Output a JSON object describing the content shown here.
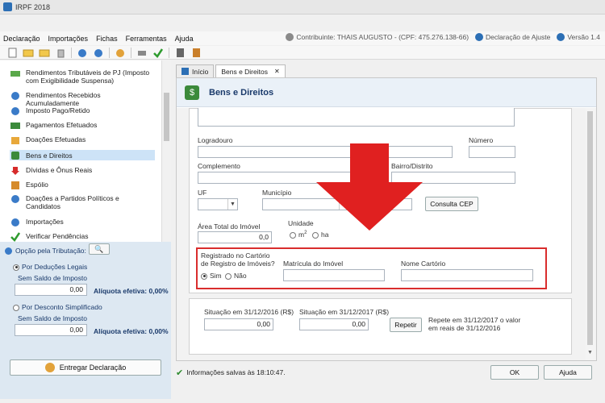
{
  "window": {
    "title": "IRPF 2018"
  },
  "menu": {
    "items": [
      "Declaração",
      "Importações",
      "Fichas",
      "Ferramentas",
      "Ajuda"
    ],
    "contribuinte": "Contribuinte: THAIS AUGUSTO - (CPF: 475.276.138-66)",
    "tipo": "Declaração de Ajuste",
    "versao": "Versão 1.4"
  },
  "sidebar": {
    "items": [
      {
        "label": "Rendimentos Tributáveis de PJ (Imposto com Exigibilidade Suspensa)",
        "icon": "money-icon"
      },
      {
        "label": "Rendimentos Recebidos Acumuladamente",
        "icon": "doc-icon"
      },
      {
        "label": "Imposto Pago/Retido",
        "icon": "tax-icon"
      },
      {
        "label": "Pagamentos Efetuados",
        "icon": "card-icon"
      },
      {
        "label": "Doações Efetuadas",
        "icon": "gift-icon"
      },
      {
        "label": "Bens e Direitos",
        "icon": "assets-icon"
      },
      {
        "label": "Dívidas e Ônus Reais",
        "icon": "down-arrow-icon"
      },
      {
        "label": "Espólio",
        "icon": "grid-icon"
      },
      {
        "label": "Doações a Partidos Políticos e Candidatos",
        "icon": "party-icon"
      },
      {
        "label": "Importações",
        "icon": "import-icon"
      },
      {
        "label": "Verificar Pendências",
        "icon": "check-icon"
      }
    ],
    "opcao_label": "Opção pela Tributação:",
    "deducoes_legais": "Por Deduções Legais",
    "saldo_label_1": "Sem Saldo de Imposto",
    "saldo_value_1": "0,00",
    "aliquota_1": "Alíquota efetiva: 0,00%",
    "desconto_simplificado": "Por Desconto Simplificado",
    "saldo_label_2": "Sem Saldo de Imposto",
    "saldo_value_2": "0,00",
    "aliquota_2": "Alíquota efetiva: 0,00%",
    "entregar": "Entregar Declaração"
  },
  "tabs": [
    {
      "label": "Início"
    },
    {
      "label": "Bens e Direitos"
    }
  ],
  "section": {
    "title": "Bens e Direitos"
  },
  "form": {
    "logradouro": "Logradouro",
    "numero": "Número",
    "complemento": "Complemento",
    "bairro": "Bairro/Distrito",
    "uf": "UF",
    "municipio": "Município",
    "cep_dash": "-",
    "consulta_cep": "Consulta CEP",
    "area_label": "Área Total do Imóvel",
    "area_value": "0,0",
    "unidade": "Unidade",
    "unit_m2": "m",
    "unit_m2_sup": "2",
    "unit_ha": "ha",
    "registrado_l1": "Registrado no Cartório",
    "registrado_l2": "de Registro de Imóveis?",
    "sim": "Sim",
    "nao": "Não",
    "matricula": "Matrícula do Imóvel",
    "nome_cartorio": "Nome Cartório"
  },
  "situacao": {
    "label_2016": "Situação em 31/12/2016 (R$)",
    "value_2016": "0,00",
    "label_2017": "Situação em 31/12/2017 (R$)",
    "value_2017": "0,00",
    "repetir": "Repetir",
    "repetir_note_1": "Repete em 31/12/2017 o valor",
    "repetir_note_2": "em reais de 31/12/2016"
  },
  "status": {
    "message": "Informações salvas às 18:10:47.",
    "ok": "OK",
    "ajuda": "Ajuda"
  },
  "colors": {
    "highlight_red": "#e02020",
    "nav_active": "#cde3f7"
  }
}
